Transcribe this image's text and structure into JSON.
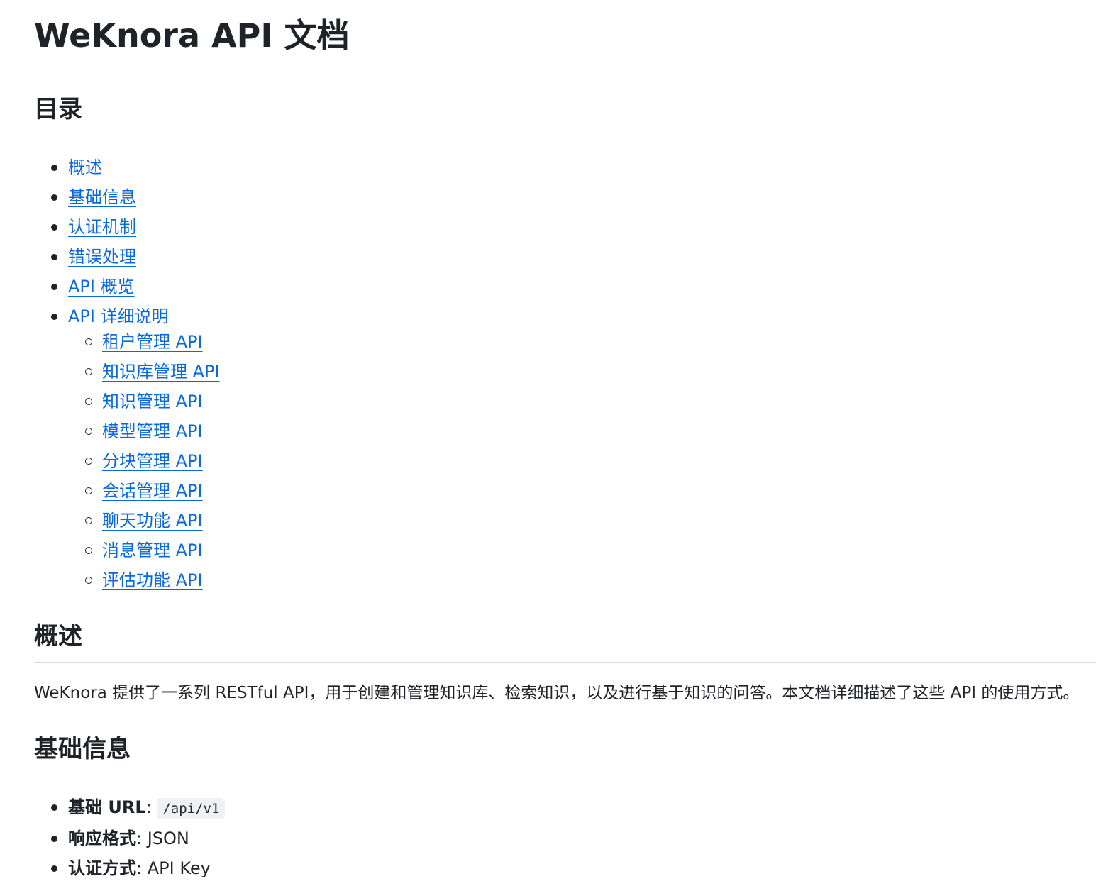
{
  "doc": {
    "title": "WeKnora API 文档"
  },
  "toc": {
    "heading": "目录",
    "items": [
      {
        "label": "概述"
      },
      {
        "label": "基础信息"
      },
      {
        "label": "认证机制"
      },
      {
        "label": "错误处理"
      },
      {
        "label": "API 概览"
      },
      {
        "label": "API 详细说明"
      }
    ],
    "subitems": [
      {
        "label": "租户管理 API"
      },
      {
        "label": "知识库管理 API"
      },
      {
        "label": "知识管理 API"
      },
      {
        "label": "模型管理 API"
      },
      {
        "label": "分块管理 API"
      },
      {
        "label": "会话管理 API"
      },
      {
        "label": "聊天功能 API"
      },
      {
        "label": "消息管理 API"
      },
      {
        "label": "评估功能 API"
      }
    ]
  },
  "overview": {
    "heading": "概述",
    "text": "WeKnora 提供了一系列 RESTful API，用于创建和管理知识库、检索知识，以及进行基于知识的问答。本文档详细描述了这些 API 的使用方式。"
  },
  "basic_info": {
    "heading": "基础信息",
    "items": [
      {
        "label": "基础 URL",
        "sep": ": ",
        "value": "/api/v1",
        "is_code": true
      },
      {
        "label": "响应格式",
        "sep": ": ",
        "value": "JSON",
        "is_code": false
      },
      {
        "label": "认证方式",
        "sep": ": ",
        "value": "API Key",
        "is_code": false
      }
    ]
  },
  "colors": {
    "link": "#0969da",
    "text": "#1f2328",
    "divider": "#d8dee4",
    "code_bg": "#eff1f3"
  }
}
